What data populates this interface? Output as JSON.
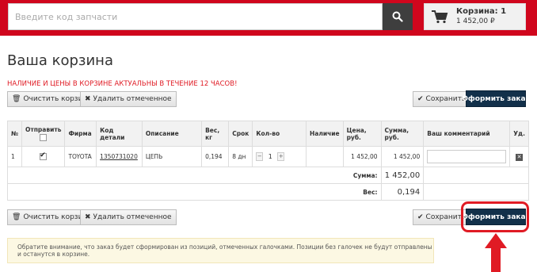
{
  "header": {
    "search_placeholder": "Введите код запчасти",
    "cart_title": "Корзина: 1",
    "cart_sum": "1 452,00 ₽"
  },
  "page": {
    "title": "Ваша корзина",
    "notice": "НАЛИЧИЕ И ЦЕНЫ В КОРЗИНЕ АКТУАЛЬНЫ В ТЕЧЕНИЕ 12 ЧАСОВ!"
  },
  "toolbar": {
    "clear_label": "Очистить корзину",
    "delete_selected_label": "Удалить отмеченное",
    "save_label": "Сохранить",
    "checkout_label": "Оформить заказ"
  },
  "table": {
    "headers": [
      "№",
      "Отправить",
      "Фирма",
      "Код детали",
      "Описание",
      "Вес, кг",
      "Срок",
      "Кол-во",
      "Наличие",
      "Цена, руб.",
      "Сумма, руб.",
      "Ваш комментарий",
      "Уд."
    ],
    "rows": [
      {
        "num": "1",
        "send": true,
        "brand": "TOYOTA",
        "code": "1350731020",
        "description": "ЦЕПЬ",
        "weight": "0,194",
        "term": "8 дн",
        "qty": "1",
        "availability": "",
        "price": "1 452,00",
        "sum": "1 452,00"
      }
    ],
    "total_sum_label": "Сумма:",
    "total_sum": "1 452,00",
    "total_weight_label": "Вес:",
    "total_weight": "0,194"
  },
  "info": {
    "text": "Обратите внимание, что заказ будет сформирован из позиций, отмеченных галочками. Позиции без галочек не будут отправлены и останутся в корзине."
  },
  "colors": {
    "brand_red": "#d0061d",
    "checkout_dark": "#12304a",
    "annotation_red": "#e01b24"
  }
}
